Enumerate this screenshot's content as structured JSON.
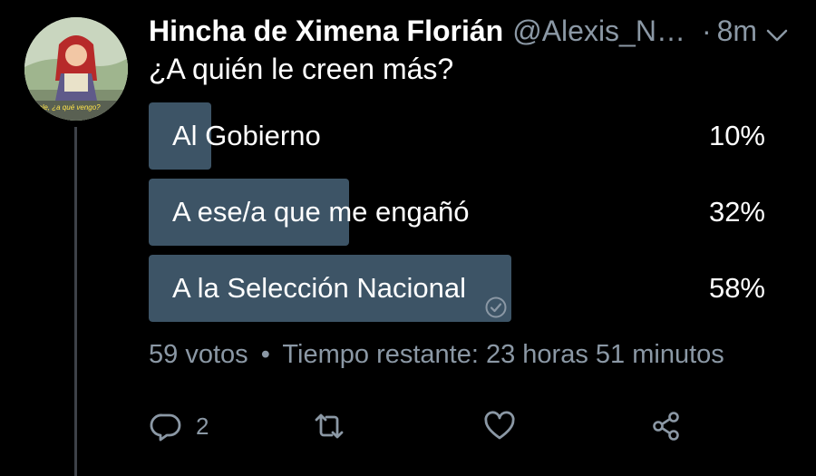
{
  "tweet": {
    "author_name": "Hincha de Ximena Florián",
    "handle": "@Alexis_N…",
    "separator": "·",
    "time": "8m",
    "text": "¿A quién le creen más?"
  },
  "avatar": {
    "caption": "¡chale, ¿a qué vengo?"
  },
  "poll": {
    "options": [
      {
        "label": "Al Gobierno",
        "percent": "10%",
        "fraction": 0.1,
        "selected": false
      },
      {
        "label": "A ese/a que me engañó",
        "percent": "32%",
        "fraction": 0.32,
        "selected": false
      },
      {
        "label": "A la Selección Nacional",
        "percent": "58%",
        "fraction": 0.58,
        "selected": true
      }
    ],
    "votes": "59 votos",
    "meta_separator": "•",
    "remaining": "Tiempo restante: 23 horas 51 minutos"
  },
  "actions": {
    "reply_count": "2",
    "icons": [
      "reply-icon",
      "retweet-icon",
      "like-icon",
      "share-icon"
    ]
  },
  "colors": {
    "background": "#000000",
    "bar": "#3d5466",
    "secondary_text": "#8b98a5",
    "thread_line": "#3d4148"
  }
}
